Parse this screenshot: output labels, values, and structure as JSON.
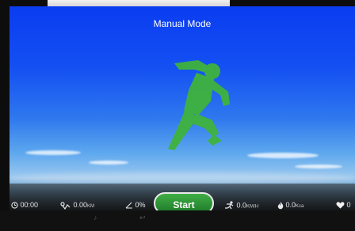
{
  "header": {
    "title": "Manual Mode"
  },
  "stats": {
    "time": {
      "value": "00:00",
      "icon": "clock-icon"
    },
    "distance": {
      "value": "0.00",
      "unit": "KM",
      "icon": "route-icon"
    },
    "incline": {
      "value": "0%",
      "icon": "incline-icon"
    },
    "speed": {
      "value": "0.0",
      "unit": "KM/H",
      "icon": "runner-icon"
    },
    "calories": {
      "value": "0.0",
      "unit": "Kca",
      "icon": "flame-icon"
    },
    "heart_rate": {
      "value": "0",
      "icon": "heart-icon"
    }
  },
  "controls": {
    "start_label": "Start"
  },
  "colors": {
    "accent_green": "#37b23f",
    "sky_top": "#0a3cf0",
    "button_border": "#eaeaea"
  }
}
